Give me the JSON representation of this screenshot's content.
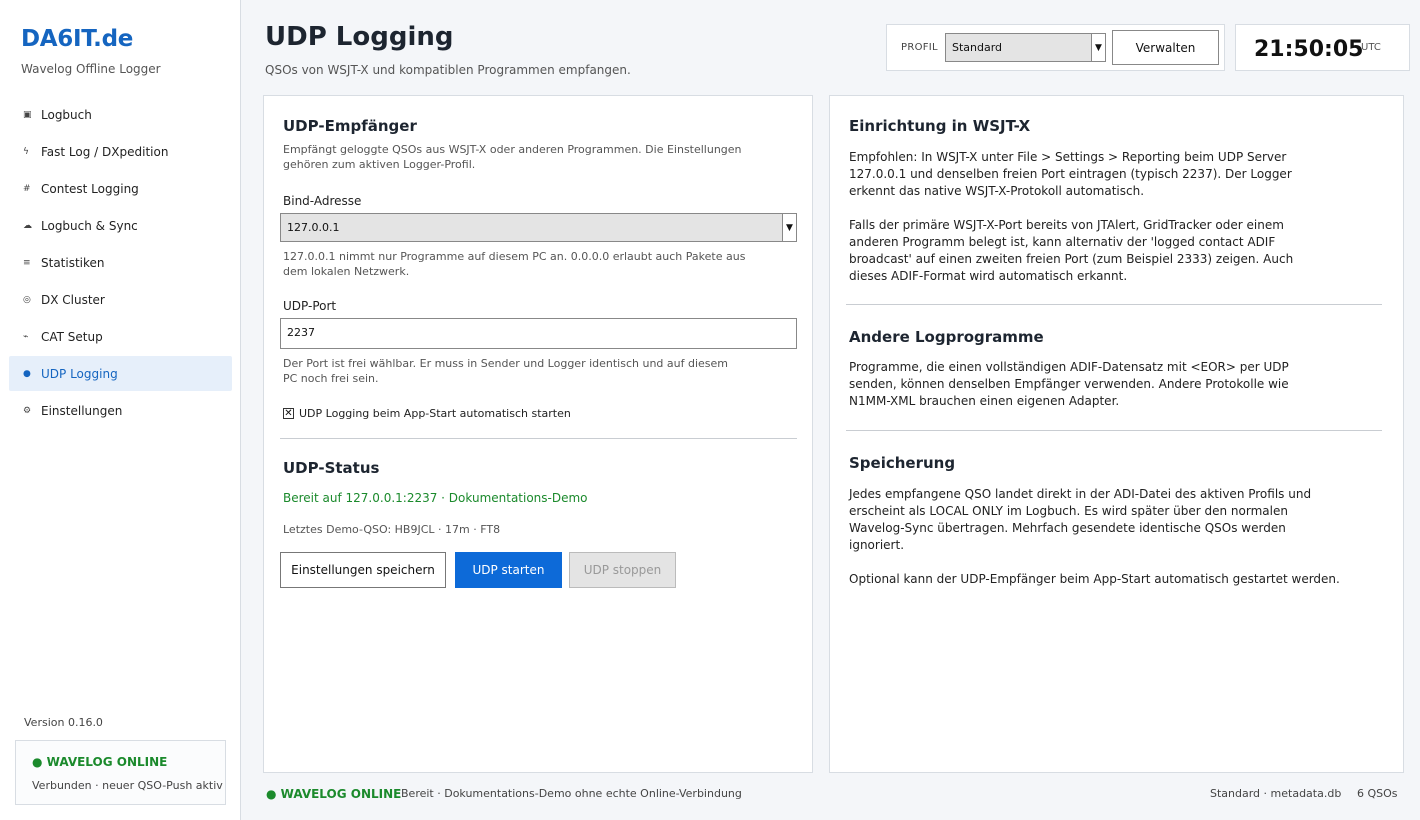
{
  "sidebar": {
    "brand": "DA6IT.de",
    "subtitle": "Wavelog Offline Logger",
    "items": [
      {
        "icon": "▣",
        "label": "Logbuch",
        "active": false
      },
      {
        "icon": "ϟ",
        "label": "Fast Log / DXpedition",
        "active": false
      },
      {
        "icon": "#",
        "label": "Contest Logging",
        "active": false
      },
      {
        "icon": "☁",
        "label": "Logbuch & Sync",
        "active": false
      },
      {
        "icon": "≡",
        "label": "Statistiken",
        "active": false
      },
      {
        "icon": "◎",
        "label": "DX Cluster",
        "active": false
      },
      {
        "icon": "⌁",
        "label": "CAT Setup",
        "active": false
      },
      {
        "icon": "●",
        "label": "UDP Logging",
        "active": true
      },
      {
        "icon": "⚙",
        "label": "Einstellungen",
        "active": false
      }
    ],
    "version": "Version 0.16.0",
    "online_title": "WAVELOG ONLINE",
    "online_sub": "Verbunden · neuer QSO-Push aktiv"
  },
  "header": {
    "title": "UDP Logging",
    "subtitle": "QSOs von WSJT-X und kompatiblen Programmen empfangen.",
    "profile_label": "PROFIL",
    "profile_value": "Standard",
    "manage_button": "Verwalten",
    "clock": "21:50:05",
    "utc": "UTC"
  },
  "receiver": {
    "title": "UDP-Empfänger",
    "description": "Empfängt geloggte QSOs aus WSJT-X oder anderen Programmen. Die Einstellungen gehören zum aktiven Logger-Profil.",
    "bind_label": "Bind-Adresse",
    "bind_value": "127.0.0.1",
    "bind_hint": "127.0.0.1 nimmt nur Programme auf diesem PC an. 0.0.0.0 erlaubt auch Pakete aus dem lokalen Netzwerk.",
    "port_label": "UDP-Port",
    "port_value": "2237",
    "port_hint": "Der Port ist frei wählbar. Er muss in Sender und Logger identisch und auf diesem PC noch frei sein.",
    "autostart_label": "UDP Logging beim App-Start automatisch starten",
    "autostart_checked": true
  },
  "status": {
    "title": "UDP-Status",
    "state": "Bereit auf 127.0.0.1:2237 · Dokumentations-Demo",
    "last_qso": "Letztes Demo-QSO: HB9JCL · 17m · FT8",
    "save_button": "Einstellungen speichern",
    "start_button": "UDP starten",
    "stop_button": "UDP stoppen"
  },
  "help": {
    "wsjtx_title": "Einrichtung in WSJT-X",
    "wsjtx_p1": "Empfohlen: In WSJT-X unter File > Settings > Reporting beim UDP Server 127.0.0.1 und denselben freien Port eintragen (typisch 2237). Der Logger erkennt das native WSJT-X-Protokoll automatisch.",
    "wsjtx_p2": "Falls der primäre WSJT-X-Port bereits von JTAlert, GridTracker oder einem anderen Programm belegt ist, kann alternativ der 'logged contact ADIF broadcast' auf einen zweiten freien Port (zum Beispiel 2333) zeigen. Auch dieses ADIF-Format wird automatisch erkannt.",
    "other_title": "Andere Logprogramme",
    "other_p1": "Programme, die einen vollständigen ADIF-Datensatz mit <EOR> per UDP senden, können denselben Empfänger verwenden. Andere Protokolle wie N1MM-XML brauchen einen eigenen Adapter.",
    "storage_title": "Speicherung",
    "storage_p1": "Jedes empfangene QSO landet direkt in der ADI-Datei des aktiven Profils und erscheint als LOCAL ONLY im Logbuch. Es wird später über den normalen Wavelog-Sync übertragen. Mehrfach gesendete identische QSOs werden ignoriert.",
    "storage_p2": "Optional kann der UDP-Empfänger beim App-Start automatisch gestartet werden."
  },
  "footer": {
    "online": "WAVELOG ONLINE",
    "status": "Bereit · Dokumentations-Demo ohne echte Online-Verbindung",
    "db": "Standard · metadata.db",
    "qsos": "6 QSOs"
  }
}
